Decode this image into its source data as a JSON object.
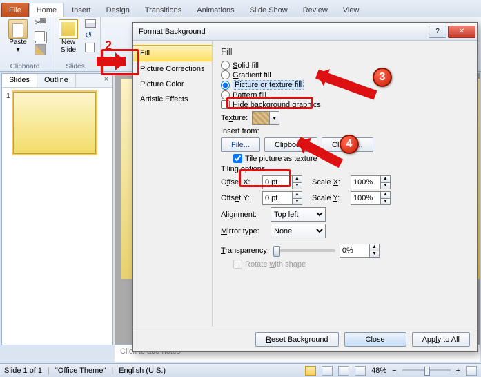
{
  "tabs": {
    "file": "File",
    "home": "Home",
    "insert": "Insert",
    "design": "Design",
    "transitions": "Transitions",
    "animations": "Animations",
    "slideshow": "Slide Show",
    "review": "Review",
    "view": "View"
  },
  "ribbon": {
    "clipboard": {
      "label": "Clipboard",
      "paste": "Paste"
    },
    "slides": {
      "label": "Slides",
      "newslide": "New\nSlide"
    }
  },
  "pane": {
    "slides": "Slides",
    "outline": "Outline",
    "num1": "1"
  },
  "notes_placeholder": "Click to add notes",
  "dialog": {
    "title": "Format Background",
    "nav": {
      "fill": "Fill",
      "pic_corr": "Picture Corrections",
      "pic_color": "Picture Color",
      "artistic": "Artistic Effects"
    },
    "heading": "Fill",
    "opts": {
      "solid": "Solid fill",
      "gradient": "Gradient fill",
      "picture": "Picture or texture fill",
      "pattern": "Pattern fill",
      "hide": "Hide background graphics"
    },
    "texture": "Texture:",
    "insert_from": "Insert from:",
    "btn_file": "File...",
    "btn_clipboard": "Clipboard",
    "btn_clipart": "Clip Art...",
    "tile": "Tile picture as texture",
    "tiling": "Tiling options",
    "offset_x": "Offset X:",
    "offset_y": "Offset Y:",
    "scale_x": "Scale X:",
    "scale_y": "Scale Y:",
    "val0pt": "0 pt",
    "val100": "100%",
    "alignment": "Alignment:",
    "al_val": "Top left",
    "mirror": "Mirror type:",
    "mi_val": "None",
    "transparency": "Transparency:",
    "tr_val": "0%",
    "rotate": "Rotate with shape",
    "reset": "Reset Background",
    "close": "Close",
    "apply": "Apply to All"
  },
  "status": {
    "slide": "Slide 1 of 1",
    "theme": "\"Office Theme\"",
    "lang": "English (U.S.)",
    "zoom": "48%"
  },
  "ann": {
    "n2": "2",
    "n3": "3",
    "n4": "4"
  }
}
